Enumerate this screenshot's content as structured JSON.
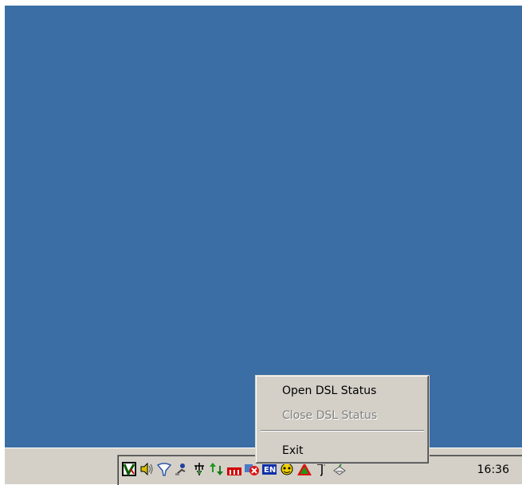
{
  "context_menu": {
    "items": [
      {
        "label": "Open DSL Status",
        "enabled": true
      },
      {
        "label": "Close DSL Status",
        "enabled": false
      },
      {
        "label": "Exit",
        "enabled": true
      }
    ]
  },
  "taskbar": {
    "clock": "16:36",
    "tray_icons": [
      "v-app-icon",
      "volume-icon",
      "funnel-icon",
      "user-network-icon",
      "network-plug-icon",
      "dsl-updown-icon",
      "bar-monitor-icon",
      "disconnected-x-icon",
      "language-en-icon",
      "antivirus-icon",
      "warning-triangle-icon",
      "small-tool-icon",
      "satellite-icon"
    ]
  },
  "colors": {
    "desktop": "#3a6ea5",
    "taskbar": "#d4d0c8",
    "menu": "#d4d0c8",
    "disabled_text": "#808080"
  }
}
